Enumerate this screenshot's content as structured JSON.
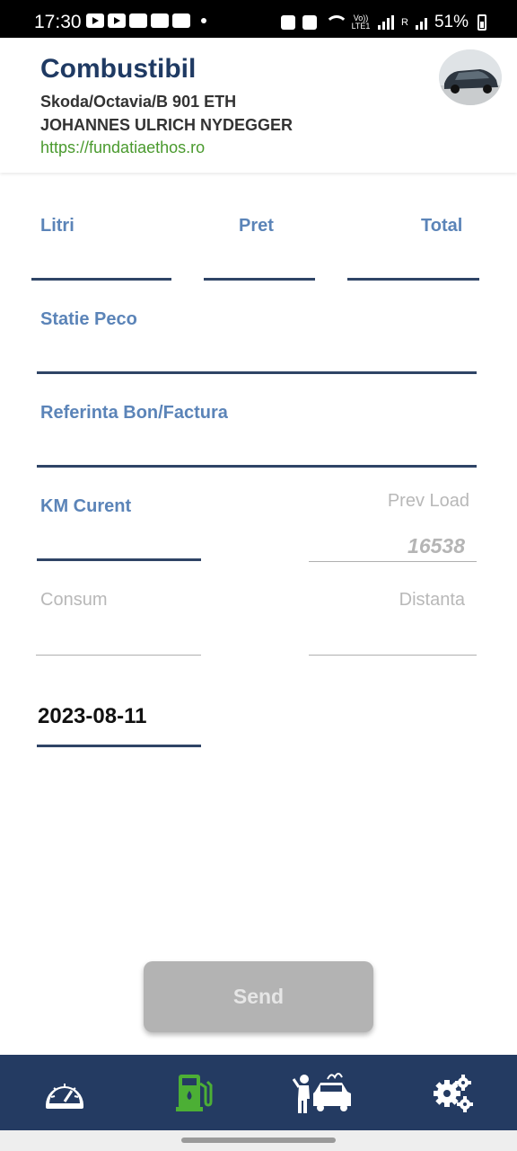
{
  "status_bar": {
    "time": "17:30",
    "battery": "51%",
    "network": "Vo)) LTE1",
    "roaming": "R"
  },
  "header": {
    "title": "Combustibil",
    "vehicle": "Skoda/Octavia/B 901 ETH",
    "driver": "JOHANNES ULRICH NYDEGGER",
    "link": "https://fundatiaethos.ro"
  },
  "form": {
    "litri_label": "Litri",
    "pret_label": "Pret",
    "total_label": "Total",
    "statie_label": "Statie Peco",
    "referinta_label": "Referinta Bon/Factura",
    "km_label": "KM Curent",
    "prev_load_label": "Prev Load",
    "prev_load_value": "16538",
    "consum_label": "Consum",
    "distanta_label": "Distanta",
    "date_value": "2023-08-11"
  },
  "actions": {
    "send_label": "Send"
  },
  "bottom_nav": {
    "items": [
      "dashboard-icon",
      "fuel-pump-icon",
      "car-repair-icon",
      "settings-gears-icon"
    ],
    "active_index": 1
  },
  "colors": {
    "title": "#1f3a63",
    "label_blue": "#5b84b8",
    "link_green": "#4a9a2e",
    "nav_bg": "#243b62",
    "active_icon": "#4caf35"
  }
}
